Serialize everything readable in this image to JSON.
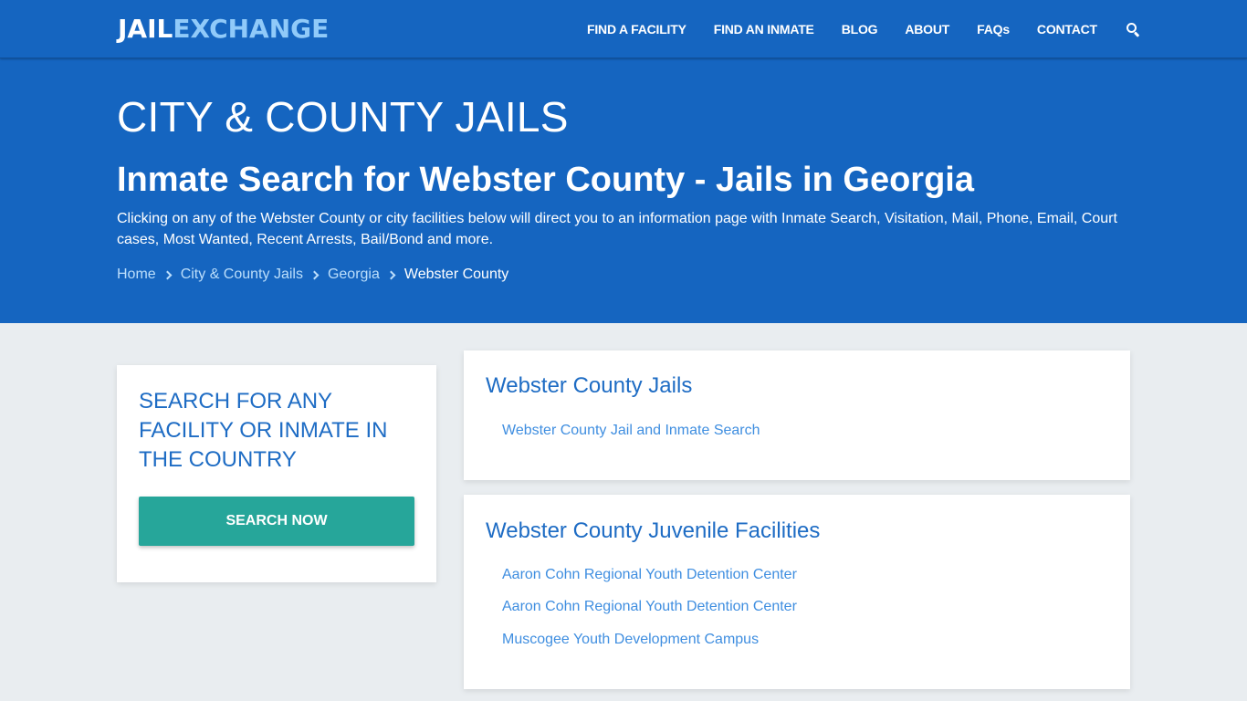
{
  "navbar": {
    "logo_part1": "JAIL",
    "logo_part2": "EXCHANGE",
    "items": [
      {
        "label": "FIND A FACILITY"
      },
      {
        "label": "FIND AN INMATE"
      },
      {
        "label": "BLOG"
      },
      {
        "label": "ABOUT"
      },
      {
        "label": "FAQs"
      },
      {
        "label": "CONTACT"
      }
    ],
    "search_icon": "search-icon"
  },
  "hero": {
    "title": "CITY & COUNTY JAILS",
    "subtitle": "Inmate Search for Webster County - Jails in Georgia",
    "description": "Clicking on any of the Webster County or city facilities below will direct you to an information page with Inmate Search, Visitation, Mail, Phone, Email, Court cases, Most Wanted, Recent Arrests, Bail/Bond and more.",
    "breadcrumb": [
      {
        "label": "Home"
      },
      {
        "label": "City & County Jails"
      },
      {
        "label": "Georgia"
      },
      {
        "label": "Webster County"
      }
    ]
  },
  "sidebar": {
    "heading": "SEARCH FOR ANY FACILITY OR INMATE IN THE COUNTRY",
    "button_label": "SEARCH NOW"
  },
  "sections": [
    {
      "heading": "Webster County Jails",
      "links": [
        "Webster County Jail and Inmate Search"
      ]
    },
    {
      "heading": "Webster County Juvenile Facilities",
      "links": [
        "Aaron Cohn Regional Youth Detention Center",
        "Aaron Cohn Regional Youth Detention Center",
        "Muscogee Youth Development Campus"
      ]
    }
  ],
  "colors": {
    "primary": "#1565c0",
    "accent_button": "#26a69a",
    "heading_blue": "#1e6cc4",
    "link_blue": "#3f8ee0",
    "background": "#e9edf0"
  }
}
